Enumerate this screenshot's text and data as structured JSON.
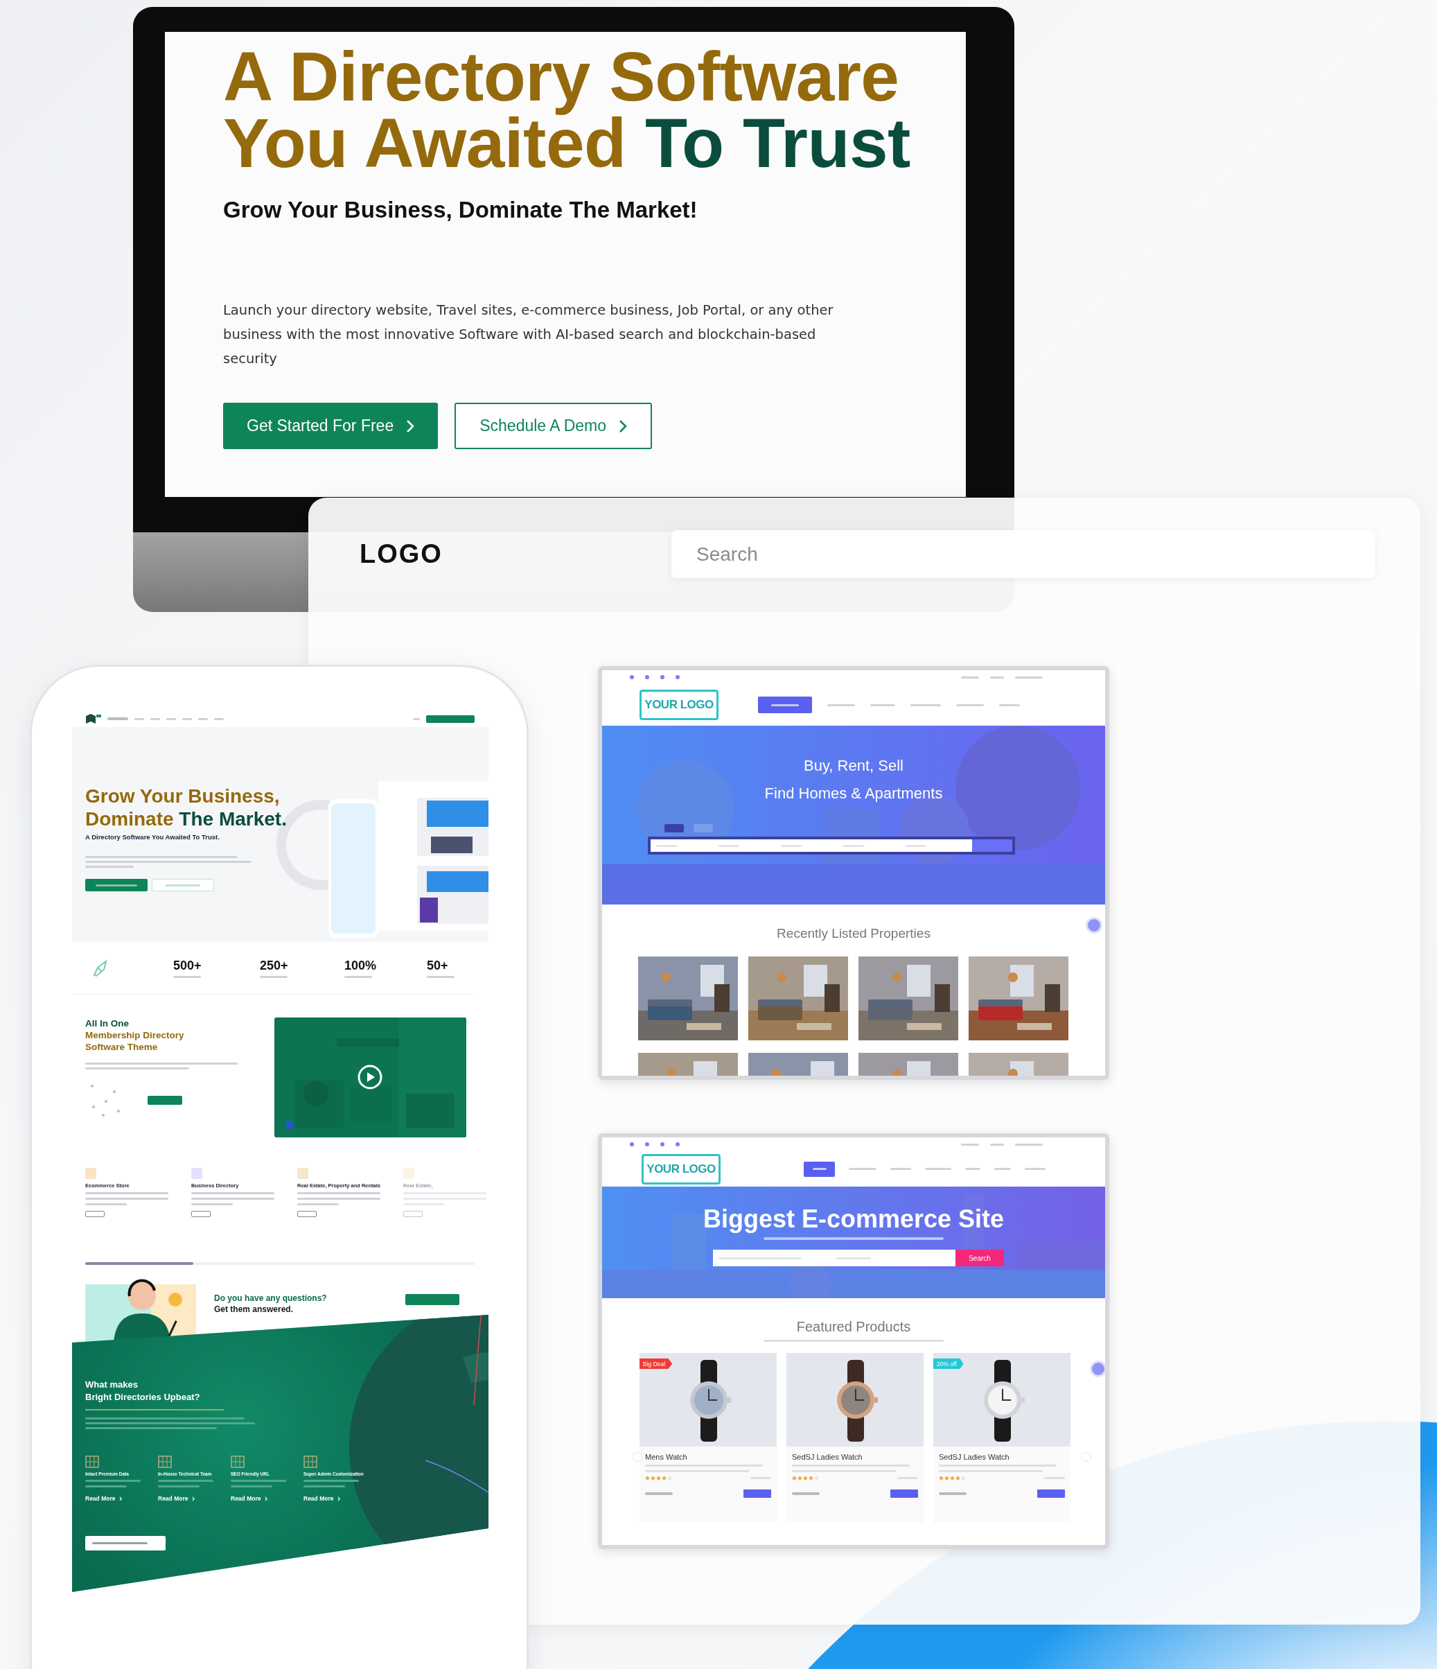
{
  "hero": {
    "headline": [
      [
        {
          "text": "A Directory Software",
          "accent": false
        }
      ],
      [
        {
          "text": "You Awaited",
          "accent": false
        },
        {
          "text": "To Trust",
          "accent": true
        }
      ]
    ],
    "subtitle": "Grow Your Business, Dominate The Market!",
    "description": "Launch your directory website, Travel sites, e-commerce business, Job Portal, or any other business with the most innovative Software with AI-based search and blockchain-based security",
    "buttons": [
      {
        "label": "Get Started For Free",
        "kind": "primary"
      },
      {
        "label": "Schedule A Demo",
        "kind": "outline"
      }
    ]
  },
  "panel": {
    "logo": "LOGO",
    "search": {
      "placeholder": "Search"
    }
  },
  "phone": {
    "hero": {
      "headline": [
        [
          {
            "text": "Grow Your Business,",
            "accent": false
          }
        ],
        [
          {
            "text": "Dominate",
            "accent": false
          },
          {
            "text": "The Market.",
            "accent": true
          }
        ]
      ],
      "tagline": "A Directory Software You Awaited To Trust."
    },
    "stats": [
      "500+",
      "250+",
      "100%",
      "50+"
    ],
    "about": {
      "headline": [
        [
          {
            "text": "All In One",
            "accent": true
          }
        ],
        [
          {
            "text": "Membership Directory",
            "accent": false
          }
        ],
        [
          {
            "text": "Software Theme",
            "accent": false
          }
        ]
      ]
    },
    "features": [
      "Ecommerce Store",
      "Business Directory",
      "Real Estate, Property and Rentals",
      "Real Estate,"
    ],
    "questions": [
      {
        "text": "Do you have any questions?",
        "accent": true
      },
      {
        "text": "Get them answered.",
        "accent": false
      }
    ],
    "upbeat": {
      "title_lines": [
        "What makes",
        "Bright Directories Upbeat?"
      ],
      "items": [
        {
          "title": "Intact Premium Data",
          "link": "Read More"
        },
        {
          "title": "In-House Technical Team",
          "link": "Read More"
        },
        {
          "title": "SEO Friendly URL",
          "link": "Read More"
        },
        {
          "title": "Super Admin Customization",
          "link": "Read More"
        }
      ]
    }
  },
  "real_estate_site": {
    "logo": "YOUR LOGO",
    "hero_lines": [
      "Buy, Rent, Sell",
      "Find Homes & Apartments"
    ],
    "section_title": "Recently Listed Properties"
  },
  "ecommerce_site": {
    "logo": "YOUR LOGO",
    "title": "Biggest E-commerce Site",
    "search_button": "Search",
    "section_title": "Featured Products",
    "products": [
      {
        "name": "Mens Watch",
        "badge": {
          "text": "Big Deal",
          "color": "#ef3b36"
        },
        "stars": 4
      },
      {
        "name": "SedSJ Ladies Watch",
        "stars": 4
      },
      {
        "name": "SedSJ Ladies Watch",
        "badge": {
          "text": "20% off",
          "color": "#22c9d6"
        },
        "stars": 4
      }
    ]
  }
}
